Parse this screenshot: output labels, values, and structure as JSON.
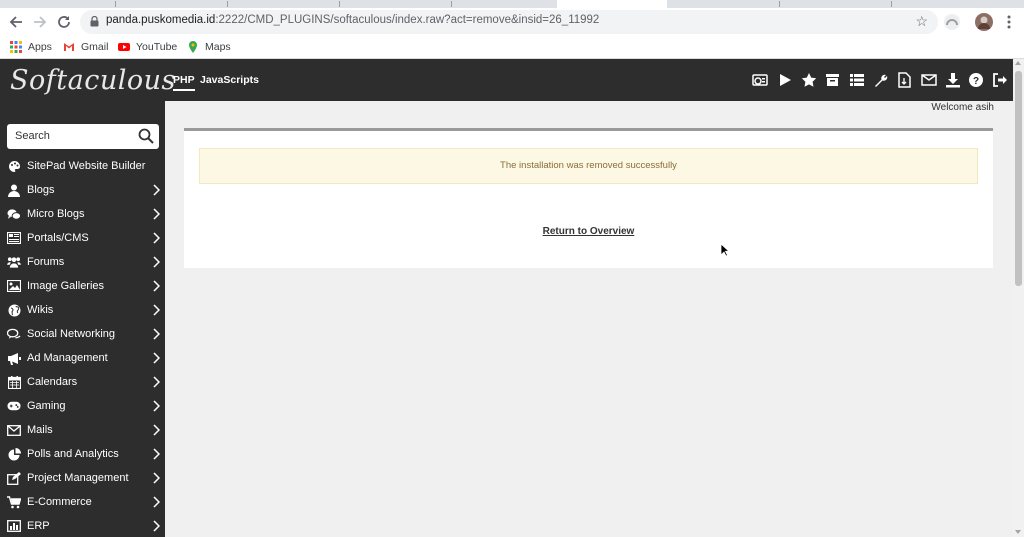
{
  "browser": {
    "url_host": "panda.puskomedia.id",
    "url_rest": ":2222/CMD_PLUGINS/softaculous/index.raw?act=remove&insid=26_11992",
    "bookmarks": [
      {
        "label": "Apps",
        "icon": "apps-grid-icon"
      },
      {
        "label": "Gmail",
        "icon": "gmail-icon"
      },
      {
        "label": "YouTube",
        "icon": "youtube-icon"
      },
      {
        "label": "Maps",
        "icon": "maps-icon"
      }
    ]
  },
  "header": {
    "logo": "Softaculous",
    "tabs": [
      "PHP",
      "JavaScripts"
    ],
    "icons": [
      "installations-icon",
      "demo-play-icon",
      "rating-star-icon",
      "backup-archive-icon",
      "list-icon",
      "settings-wrench-icon",
      "import-file-icon",
      "email-icon",
      "download-icon",
      "help-icon",
      "logout-icon"
    ]
  },
  "sidebar": {
    "search_placeholder": "Search",
    "items": [
      {
        "label": "SitePad Website Builder",
        "icon": "sitepad-palette-icon",
        "chevron": false
      },
      {
        "label": "Blogs",
        "icon": "user-icon",
        "chevron": true
      },
      {
        "label": "Micro Blogs",
        "icon": "chat-icon",
        "chevron": true
      },
      {
        "label": "Portals/CMS",
        "icon": "newspaper-icon",
        "chevron": true
      },
      {
        "label": "Forums",
        "icon": "users-icon",
        "chevron": true
      },
      {
        "label": "Image Galleries",
        "icon": "image-icon",
        "chevron": true
      },
      {
        "label": "Wikis",
        "icon": "globe-icon",
        "chevron": true
      },
      {
        "label": "Social Networking",
        "icon": "comments-icon",
        "chevron": true
      },
      {
        "label": "Ad Management",
        "icon": "bullhorn-icon",
        "chevron": true
      },
      {
        "label": "Calendars",
        "icon": "calendar-icon",
        "chevron": true
      },
      {
        "label": "Gaming",
        "icon": "gamepad-icon",
        "chevron": true
      },
      {
        "label": "Mails",
        "icon": "envelope-icon",
        "chevron": true
      },
      {
        "label": "Polls and Analytics",
        "icon": "pie-chart-icon",
        "chevron": true
      },
      {
        "label": "Project Management",
        "icon": "edit-icon",
        "chevron": true
      },
      {
        "label": "E-Commerce",
        "icon": "cart-icon",
        "chevron": true
      },
      {
        "label": "ERP",
        "icon": "bar-chart-icon",
        "chevron": true
      }
    ]
  },
  "main": {
    "welcome": "Welcome asih",
    "alert": "The installation was removed successfully",
    "return_link": "Return to Overview"
  }
}
